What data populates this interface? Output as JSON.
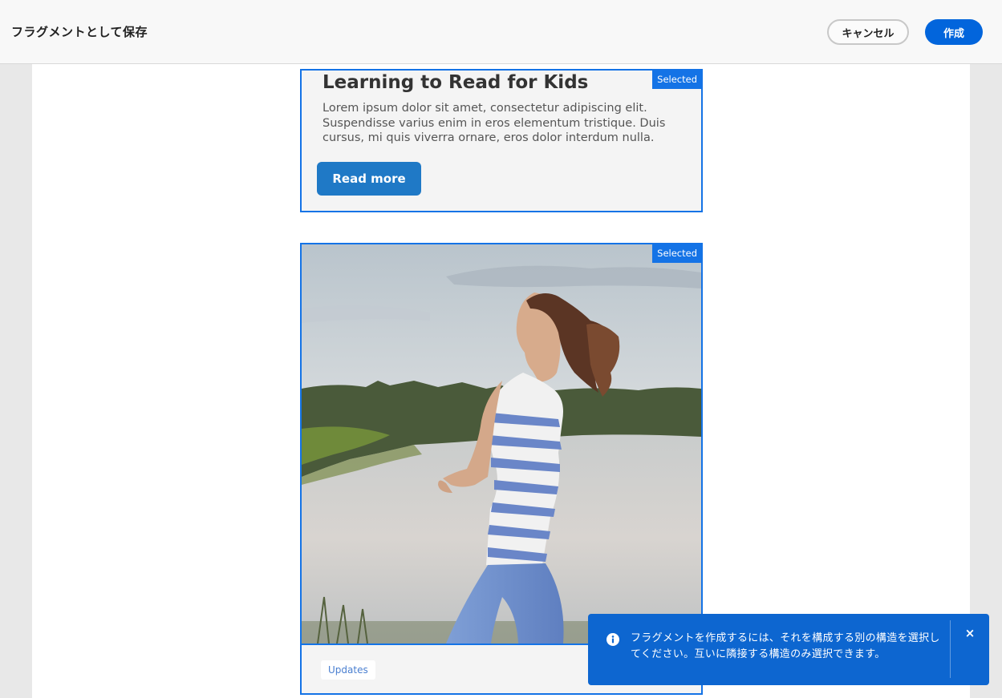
{
  "header": {
    "title": "フラグメントとして保存",
    "cancel_label": "キャンセル",
    "create_label": "作成"
  },
  "card_text": {
    "heading": "Learning to Read for Kids",
    "body": "Lorem ipsum dolor sit amet, consectetur adipiscing elit. Suspendisse varius enim in eros elementum tristique. Duis cursus, mi quis viverra ornare, eros dolor interdum nulla.",
    "button_label": "Read more",
    "badge": "Selected"
  },
  "card_image": {
    "badge": "Selected",
    "tag": "Updates"
  },
  "toast": {
    "icon": "info-icon",
    "message": "フラグメントを作成するには、それを構成する別の構造を選択してください。互いに隣接する構造のみ選択できます。",
    "close_glyph": "×"
  },
  "colors": {
    "accent": "#1473e6",
    "primary_button": "#0265dc",
    "read_more_button": "#1f79c6",
    "toast_bg": "#0d66d0"
  }
}
